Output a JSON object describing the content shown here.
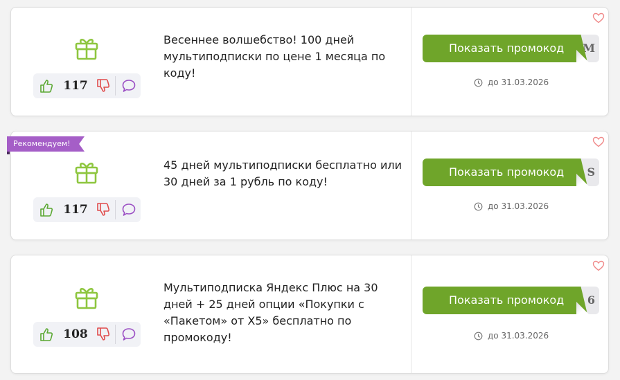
{
  "offers": [
    {
      "votes": "117",
      "description": "Весеннее волшебство! 100 дней мультиподписки по цене 1 месяца по коду!",
      "button_label": "Показать промокод",
      "code_peek": "M",
      "expiry": "до 31.03.2026"
    },
    {
      "badge": "Рекомендуем!",
      "votes": "117",
      "description": "45 дней мультиподписки бесплатно или 30 дней за 1 рубль по коду!",
      "button_label": "Показать промокод",
      "code_peek": "S",
      "expiry": "до 31.03.2026"
    },
    {
      "votes": "108",
      "description": "Мультиподписка Яндекс Плюс на 30 дней + 25 дней опции «Покупки с «Пакетом» от X5» бесплатно по промокоду!",
      "button_label": "Показать промокод",
      "code_peek": "6",
      "expiry": "до 31.03.2026"
    }
  ],
  "icons": {
    "gift": "gift-icon",
    "like": "thumbs-up-icon",
    "dislike": "thumbs-down-icon",
    "comment": "comment-icon",
    "favorite": "heart-icon",
    "clock": "clock-icon"
  },
  "colors": {
    "button": "#6fa52a",
    "gift": "#8ec63f",
    "like": "#5aa832",
    "dislike": "#e04b4b",
    "comment": "#9b4fc4",
    "heart": "#f08a8a",
    "badge": "#a55ec7"
  }
}
